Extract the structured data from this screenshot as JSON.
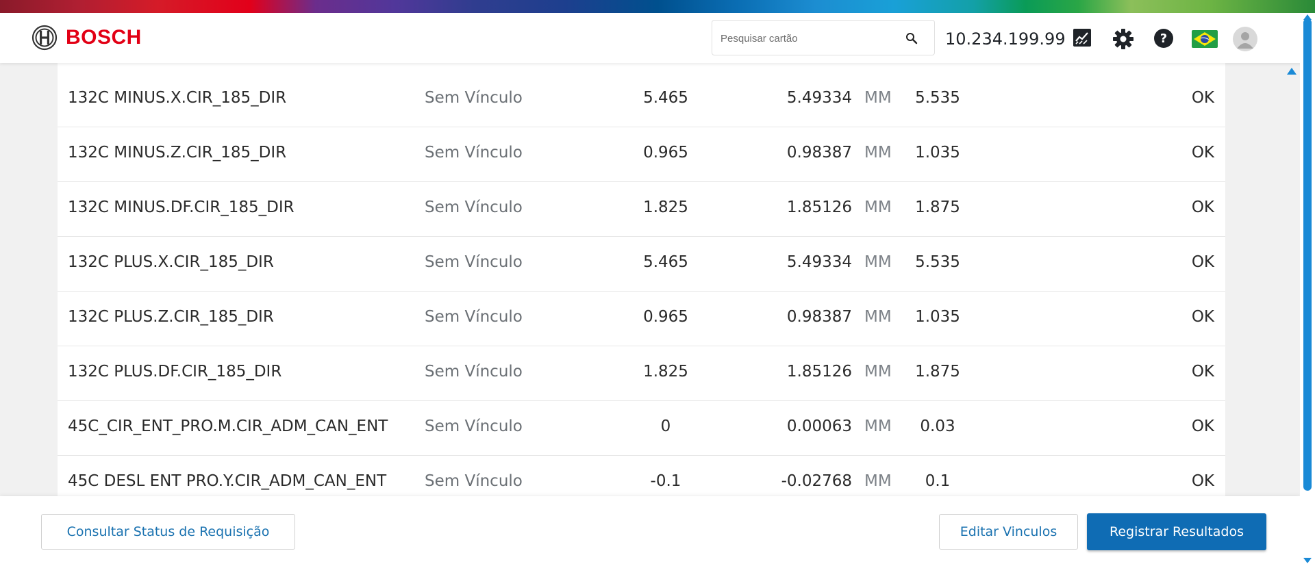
{
  "brand": {
    "name": "BOSCH",
    "color": "#e20015"
  },
  "search": {
    "placeholder": "Pesquisar cartão",
    "icon": "search-icon"
  },
  "header": {
    "ip_address": "10.234.199.99",
    "icons": [
      "trend-chart-icon",
      "gear-icon",
      "help-icon",
      "brazil-flag-icon",
      "user-avatar-icon"
    ]
  },
  "rows": [
    {
      "name": "132C MINUS.X.CIR_185_DIR",
      "vinculo": "Sem Vínculo",
      "min": "5.465",
      "value": "5.49334",
      "unit": "MM",
      "max": "5.535",
      "status": "OK"
    },
    {
      "name": "132C MINUS.Z.CIR_185_DIR",
      "vinculo": "Sem Vínculo",
      "min": "0.965",
      "value": "0.98387",
      "unit": "MM",
      "max": "1.035",
      "status": "OK"
    },
    {
      "name": "132C MINUS.DF.CIR_185_DIR",
      "vinculo": "Sem Vínculo",
      "min": "1.825",
      "value": "1.85126",
      "unit": "MM",
      "max": "1.875",
      "status": "OK"
    },
    {
      "name": "132C PLUS.X.CIR_185_DIR",
      "vinculo": "Sem Vínculo",
      "min": "5.465",
      "value": "5.49334",
      "unit": "MM",
      "max": "5.535",
      "status": "OK"
    },
    {
      "name": "132C PLUS.Z.CIR_185_DIR",
      "vinculo": "Sem Vínculo",
      "min": "0.965",
      "value": "0.98387",
      "unit": "MM",
      "max": "1.035",
      "status": "OK"
    },
    {
      "name": "132C PLUS.DF.CIR_185_DIR",
      "vinculo": "Sem Vínculo",
      "min": "1.825",
      "value": "1.85126",
      "unit": "MM",
      "max": "1.875",
      "status": "OK"
    },
    {
      "name": "45C_CIR_ENT_PRO.M.CIR_ADM_CAN_ENT",
      "vinculo": "Sem Vínculo",
      "min": "0",
      "value": "0.00063",
      "unit": "MM",
      "max": "0.03",
      "status": "OK"
    },
    {
      "name": "45C DESL ENT PRO.Y.CIR_ADM_CAN_ENT",
      "vinculo": "Sem Vínculo",
      "min": "-0.1",
      "value": "-0.02768",
      "unit": "MM",
      "max": "0.1",
      "status": "OK"
    }
  ],
  "footer": {
    "consultar_label": "Consultar Status de Requisição",
    "editar_label": "Editar Vinculos",
    "registrar_label": "Registrar Resultados"
  },
  "colors": {
    "primary": "#0f6cb4",
    "link": "#1a72b0",
    "scrollbar": "#1a8ad6"
  }
}
